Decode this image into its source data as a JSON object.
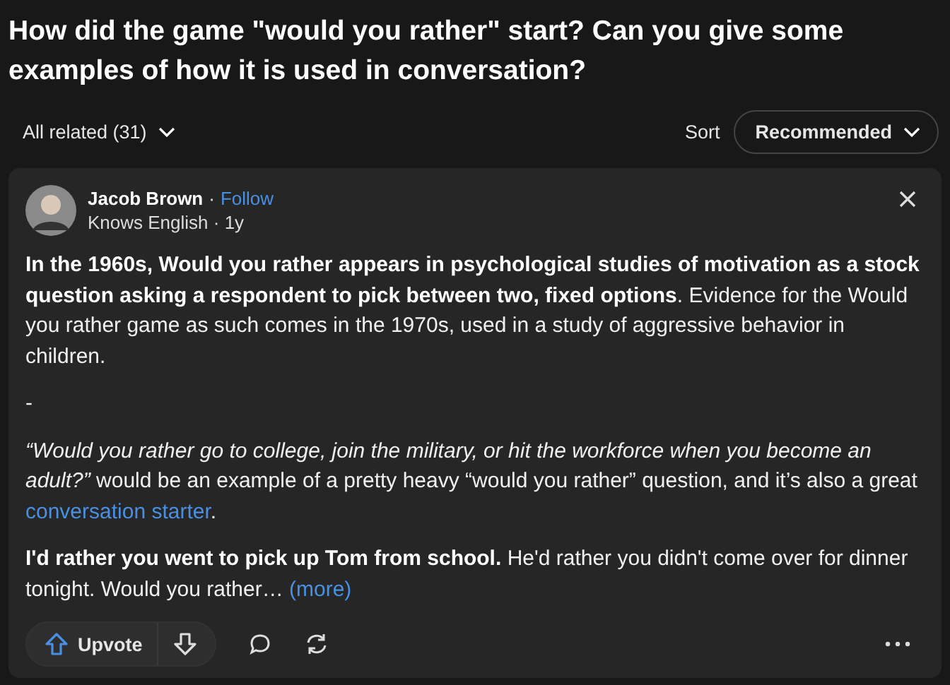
{
  "question": {
    "title": "How did the game \"would you rather\" start? Can you give some examples of how it is used in conversation?"
  },
  "filter": {
    "label": "All related (31)"
  },
  "sort": {
    "label": "Sort",
    "value": "Recommended"
  },
  "answer": {
    "author": "Jacob Brown",
    "separator": "·",
    "follow": "Follow",
    "credential": "Knows English · 1y",
    "paragraphs": [
      [
        {
          "kind": "text",
          "text": "**In the 1960s, Would you rather appears in psychological studies of motivation as a stock question asking a respondent to pick between two, fixed options**. Evidence for the Would you rather game as such comes in the 1970s, used in a study of aggressive behavior in children."
        }
      ],
      [
        {
          "kind": "text",
          "text": "-"
        }
      ],
      [
        {
          "kind": "text",
          "text": "*“Would you rather go to college, join the military, or hit the workforce when you become an adult?”* would be an example of a pretty heavy “would you rather” question, and it’s also a great "
        },
        {
          "kind": "link",
          "text": "conversation starter"
        },
        {
          "kind": "text",
          "text": "."
        }
      ],
      [
        {
          "kind": "text",
          "text": "**I'd rather you went to pick up Tom from school.** He'd rather you didn't come over for dinner tonight. Would you rather… "
        },
        {
          "kind": "link",
          "text": "(more)"
        }
      ]
    ],
    "upvote": "Upvote"
  }
}
